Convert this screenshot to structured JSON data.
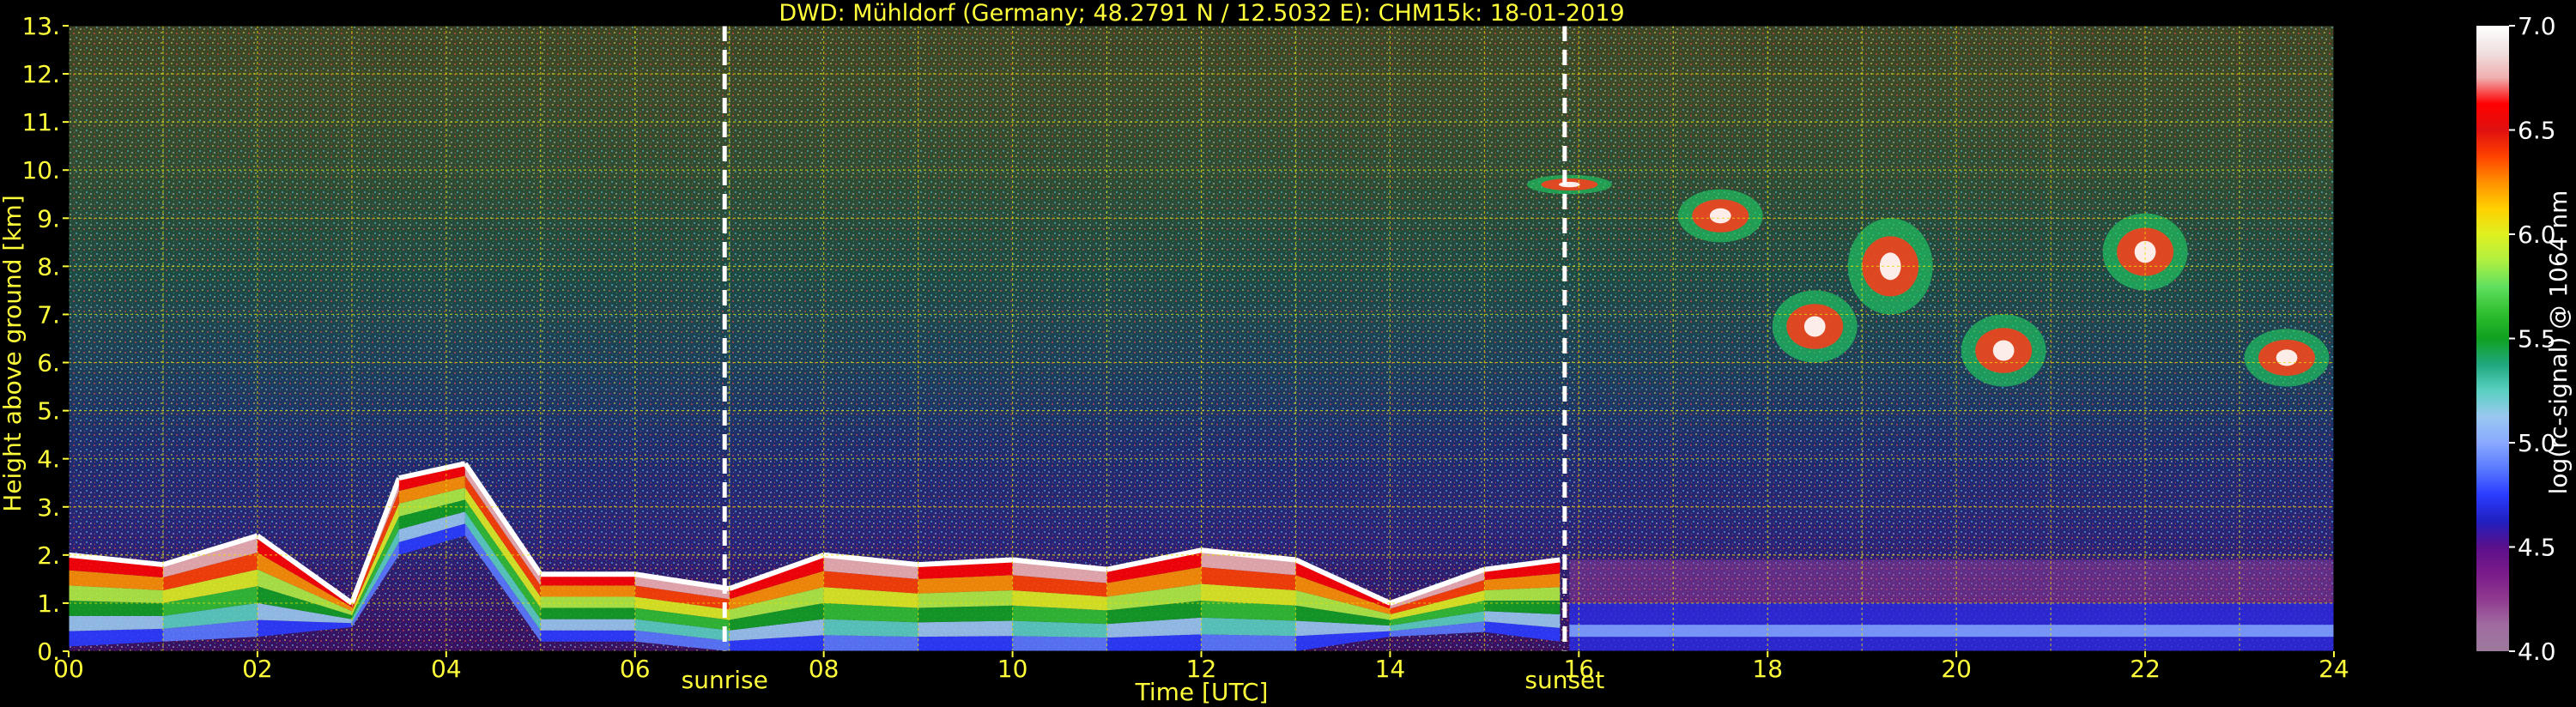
{
  "chart_data": {
    "type": "heatmap",
    "title": "DWD: Mühldorf (Germany; 48.2791 N / 12.5032 E):    CHM15k: 18-01-2019",
    "xlabel": "Time [UTC]",
    "ylabel": "Height above ground [km]",
    "xlim": [
      0,
      24
    ],
    "ylim": [
      0,
      13
    ],
    "x_ticks": [
      "00",
      "02",
      "04",
      "06",
      "08",
      "10",
      "12",
      "14",
      "16",
      "18",
      "20",
      "22",
      "24"
    ],
    "y_ticks": [
      "0.",
      "1.",
      "2.",
      "3.",
      "4.",
      "5.",
      "6.",
      "7.",
      "8.",
      "9.",
      "10.",
      "11.",
      "12.",
      "13."
    ],
    "grid": true,
    "colorbar": {
      "label": "log(rc-signal) @ 1064 nm",
      "range": [
        4.0,
        7.0
      ],
      "ticks": [
        "4.0",
        "4.5",
        "5.0",
        "5.5",
        "6.0",
        "6.5",
        "7.0"
      ],
      "colors": [
        "#9c7a9c",
        "#a06ca0",
        "#903a90",
        "#7a1a8a",
        "#5a108a",
        "#2020c0",
        "#2a3cff",
        "#5a7aff",
        "#8aa8ff",
        "#9ac8f0",
        "#5ad0c0",
        "#20a880",
        "#10a020",
        "#30c030",
        "#60e060",
        "#b0f040",
        "#e0f020",
        "#ffd000",
        "#ff9000",
        "#ff4000",
        "#e01010",
        "#ff0000",
        "#f0b0b0",
        "#f0e0e0",
        "#ffffff"
      ]
    },
    "markers": [
      {
        "label": "sunrise",
        "x": 6.95
      },
      {
        "label": "sunset",
        "x": 15.85
      }
    ],
    "cloud_base_layer": [
      {
        "t": 0.0,
        "base": 0.1,
        "top": 2.0
      },
      {
        "t": 1.0,
        "base": 0.2,
        "top": 1.8
      },
      {
        "t": 2.0,
        "base": 0.3,
        "top": 2.4
      },
      {
        "t": 3.0,
        "base": 0.5,
        "top": 1.0
      },
      {
        "t": 3.5,
        "base": 2.0,
        "top": 3.6
      },
      {
        "t": 4.2,
        "base": 2.4,
        "top": 3.9
      },
      {
        "t": 5.0,
        "base": 0.2,
        "top": 1.6
      },
      {
        "t": 6.0,
        "base": 0.2,
        "top": 1.6
      },
      {
        "t": 7.0,
        "base": 0.0,
        "top": 1.3
      },
      {
        "t": 8.0,
        "base": 0.0,
        "top": 2.0
      },
      {
        "t": 9.0,
        "base": 0.0,
        "top": 1.8
      },
      {
        "t": 10.0,
        "base": 0.0,
        "top": 1.9
      },
      {
        "t": 11.0,
        "base": 0.0,
        "top": 1.7
      },
      {
        "t": 12.0,
        "base": 0.0,
        "top": 2.1
      },
      {
        "t": 13.0,
        "base": 0.0,
        "top": 1.9
      },
      {
        "t": 14.0,
        "base": 0.3,
        "top": 1.0
      },
      {
        "t": 15.0,
        "base": 0.4,
        "top": 1.7
      },
      {
        "t": 15.8,
        "base": 0.2,
        "top": 1.9
      }
    ],
    "upper_clouds": [
      {
        "t": 15.9,
        "base": 9.5,
        "top": 9.9
      },
      {
        "t": 17.5,
        "base": 8.5,
        "top": 9.6
      },
      {
        "t": 18.5,
        "base": 6.0,
        "top": 7.5
      },
      {
        "t": 19.3,
        "base": 7.0,
        "top": 9.0
      },
      {
        "t": 20.5,
        "base": 5.5,
        "top": 7.0
      },
      {
        "t": 22.0,
        "base": 7.5,
        "top": 9.1
      },
      {
        "t": 23.5,
        "base": 5.5,
        "top": 6.7
      }
    ],
    "boundary_layer_night": {
      "t_start": 15.9,
      "t_end": 24.0,
      "top": 1.0
    }
  }
}
